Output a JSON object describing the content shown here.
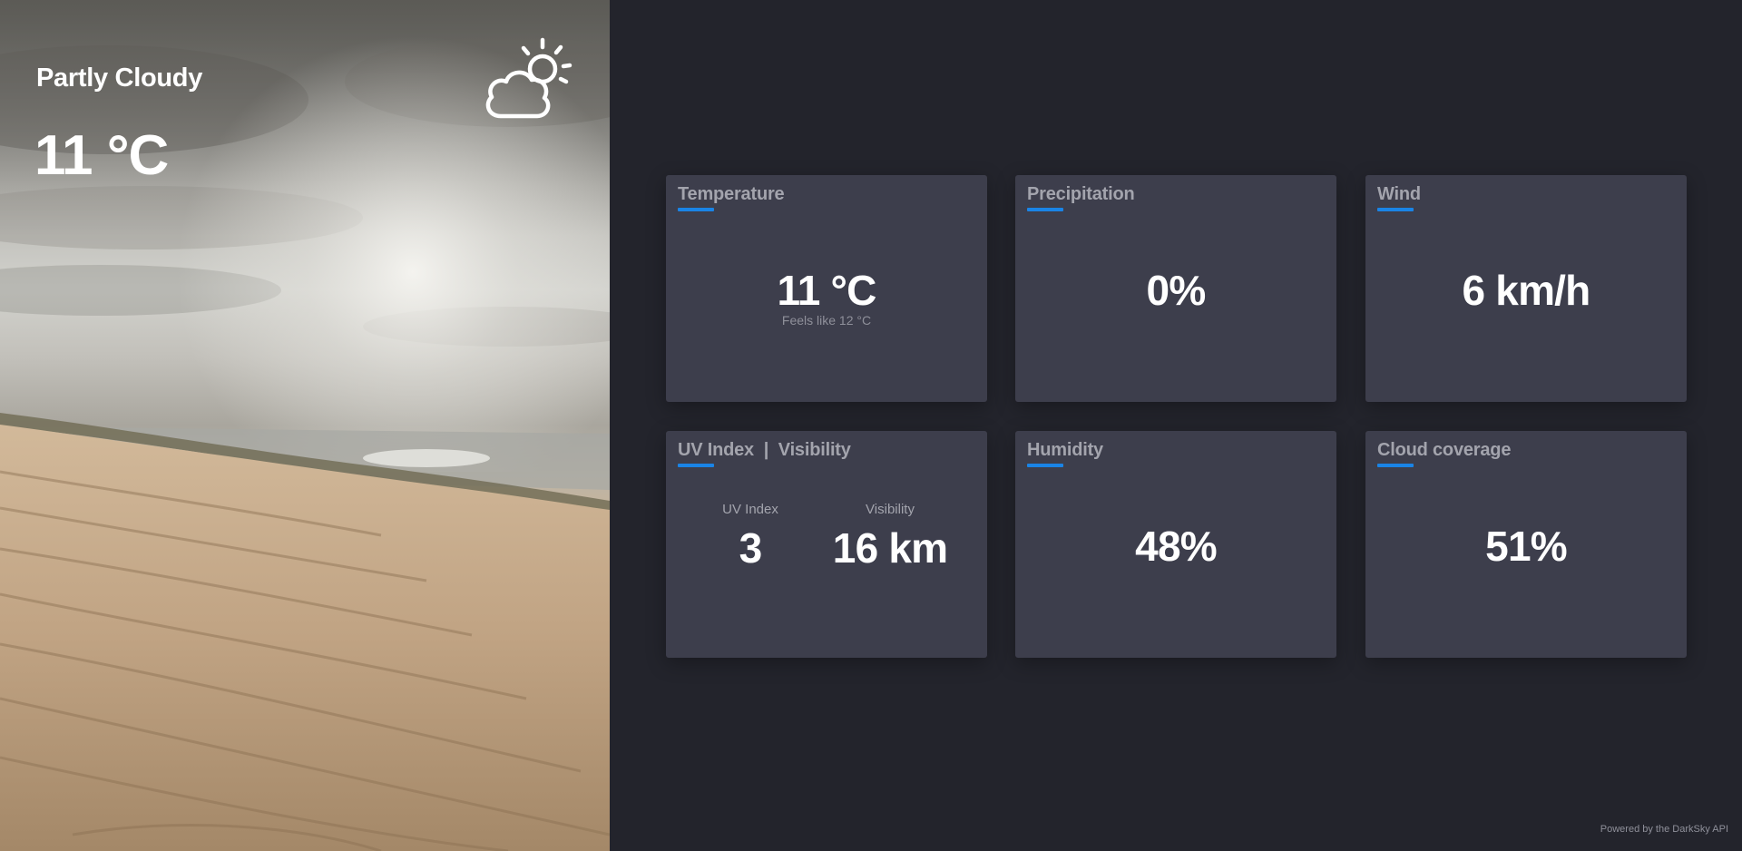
{
  "current": {
    "condition": "Partly Cloudy",
    "temperature": "11 °C",
    "icon": "partly-cloudy-day-icon"
  },
  "cards": {
    "temperature": {
      "title": "Temperature",
      "value": "11 °C",
      "feels_like": "Feels like 12 °C"
    },
    "precipitation": {
      "title": "Precipitation",
      "value": "0%"
    },
    "wind": {
      "title": "Wind",
      "value": "6 km/h"
    },
    "uv_visibility": {
      "title": "UV Index  |  Visibility",
      "uv_label": "UV Index",
      "uv_value": "3",
      "visibility_label": "Visibility",
      "visibility_value": "16 km"
    },
    "humidity": {
      "title": "Humidity",
      "value": "48%"
    },
    "cloud_coverage": {
      "title": "Cloud coverage",
      "value": "51%"
    }
  },
  "footer": {
    "text": "Powered by the DarkSky API"
  },
  "colors": {
    "background": "#23242c",
    "card": "#3d3e4c",
    "accent": "#1a84e6",
    "title_text": "#a3a4ad",
    "value_text": "#ffffff"
  }
}
